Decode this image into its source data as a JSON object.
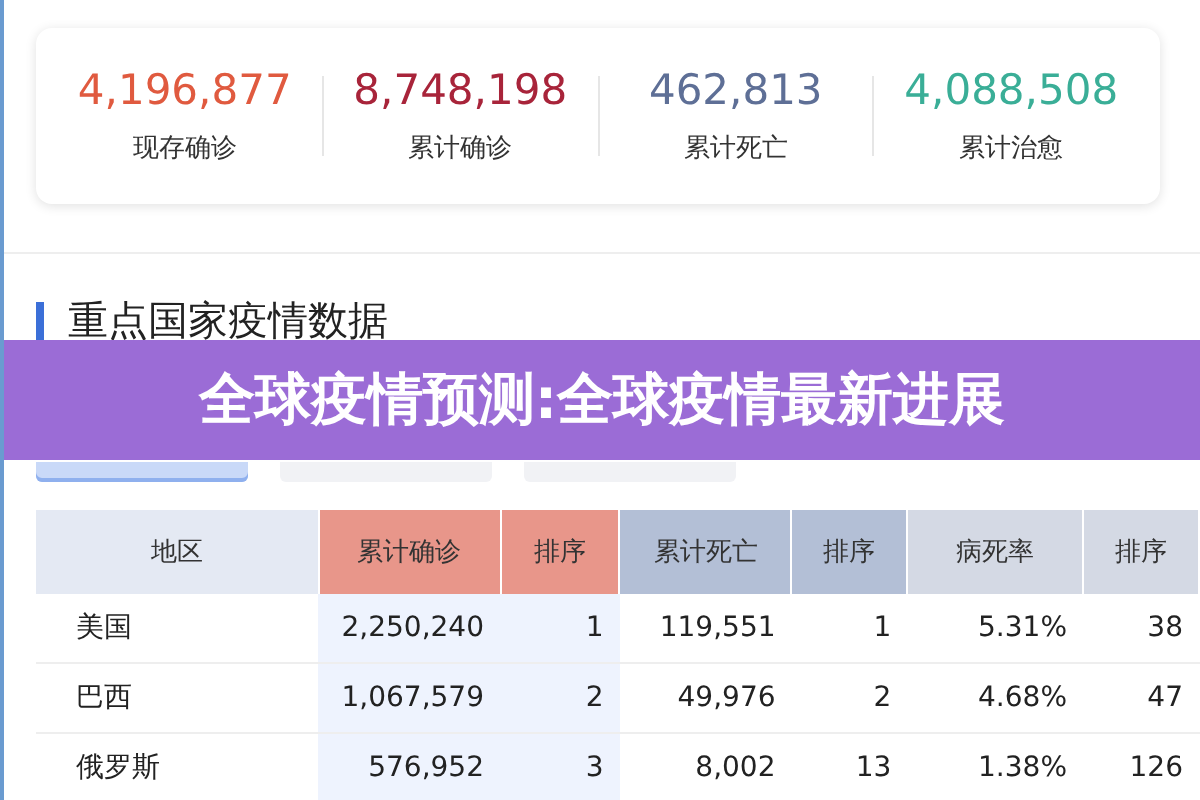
{
  "stats": [
    {
      "value": "4,196,877",
      "label": "现存确诊",
      "color": "#e05a3f"
    },
    {
      "value": "8,748,198",
      "label": "累计确诊",
      "color": "#a8243a"
    },
    {
      "value": "462,813",
      "label": "累计死亡",
      "color": "#5e6f96"
    },
    {
      "value": "4,088,508",
      "label": "累计治愈",
      "color": "#3aae97"
    }
  ],
  "section": {
    "title": "重点国家疫情数据"
  },
  "banner": {
    "text": "全球疫情预测:全球疫情最新进展"
  },
  "tabs": [
    {
      "selected": true
    },
    {
      "selected": false
    },
    {
      "selected": false
    }
  ],
  "table": {
    "columns": [
      {
        "label": "地区",
        "kind": "region",
        "highlighted": false
      },
      {
        "label": "累计确诊",
        "kind": "confirmed",
        "highlighted": true
      },
      {
        "label": "排序",
        "kind": "confirmed",
        "highlighted": true
      },
      {
        "label": "累计死亡",
        "kind": "death",
        "highlighted": false
      },
      {
        "label": "排序",
        "kind": "death",
        "highlighted": false
      },
      {
        "label": "病死率",
        "kind": "rate",
        "highlighted": false
      },
      {
        "label": "排序",
        "kind": "rate",
        "highlighted": false
      }
    ],
    "rows": [
      [
        "美国",
        "2,250,240",
        "1",
        "119,551",
        "1",
        "5.31%",
        "38"
      ],
      [
        "巴西",
        "1,067,579",
        "2",
        "49,976",
        "2",
        "4.68%",
        "47"
      ],
      [
        "俄罗斯",
        "576,952",
        "3",
        "8,002",
        "13",
        "1.38%",
        "126"
      ]
    ]
  }
}
